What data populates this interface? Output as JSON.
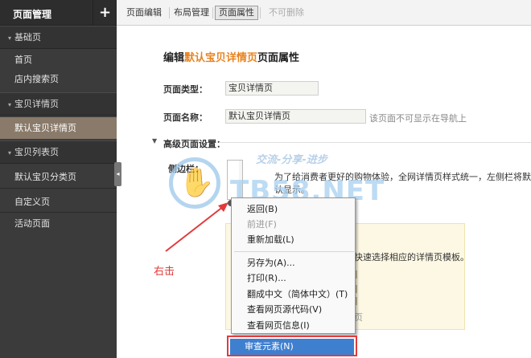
{
  "sidebar": {
    "title": "页面管理",
    "add_icon": "+",
    "groups": [
      {
        "label": "基础页",
        "items": [
          "首页",
          "店内搜索页"
        ]
      },
      {
        "label": "宝贝详情页",
        "items": [
          "默认宝贝详情页"
        ]
      },
      {
        "label": "宝贝列表页",
        "items": [
          "默认宝贝分类页"
        ]
      }
    ],
    "extra_items": [
      "自定义页",
      "活动页面"
    ],
    "collapse_icon": "◂"
  },
  "toolbar": {
    "tabs": [
      "页面编辑",
      "布局管理",
      "页面属性"
    ],
    "active_tab": "页面属性",
    "disabled_action": "不可删除"
  },
  "main": {
    "heading_prefix": "编辑",
    "heading_highlight": "默认宝贝详情页",
    "heading_suffix": "页面属性",
    "page_type_label": "页面类型：",
    "page_type_value": "宝贝详情页",
    "page_name_label": "页面名称：",
    "page_name_value": "默认宝贝详情页",
    "page_name_hint": "该页面不可显示在导航上",
    "advanced_label": "高级页面设置：",
    "sidebar_label": "侧边栏：",
    "sidebar_desc": "为了给消费者更好的购物体验，全网详情页样式统一，左侧栏将默认显示。",
    "template_hint": "快速选择相应的详情页模板。",
    "template_letter": "页"
  },
  "watermark": {
    "text": "TB58.NET",
    "sub": "交流-分享-进步"
  },
  "annotation": {
    "right_click": "右击"
  },
  "context_menu": {
    "items": [
      {
        "label": "返回(B)",
        "disabled": false
      },
      {
        "label": "前进(F)",
        "disabled": true
      },
      {
        "label": "重新加载(L)",
        "disabled": false
      },
      {
        "label": "另存为(A)...",
        "disabled": false
      },
      {
        "label": "打印(R)...",
        "disabled": false
      },
      {
        "label": "翻成中文（简体中文）(T)",
        "disabled": false
      },
      {
        "label": "查看网页源代码(V)",
        "disabled": false
      },
      {
        "label": "查看网页信息(I)",
        "disabled": false
      }
    ],
    "inspect": "审查元素(N)"
  },
  "colors": {
    "highlight": "#e8821e",
    "annotation_red": "#e23b3b",
    "menu_selected": "#3f7fcf",
    "sidebar_bg": "#3b3b3b",
    "sidebar_active": "#8a7a6a"
  }
}
